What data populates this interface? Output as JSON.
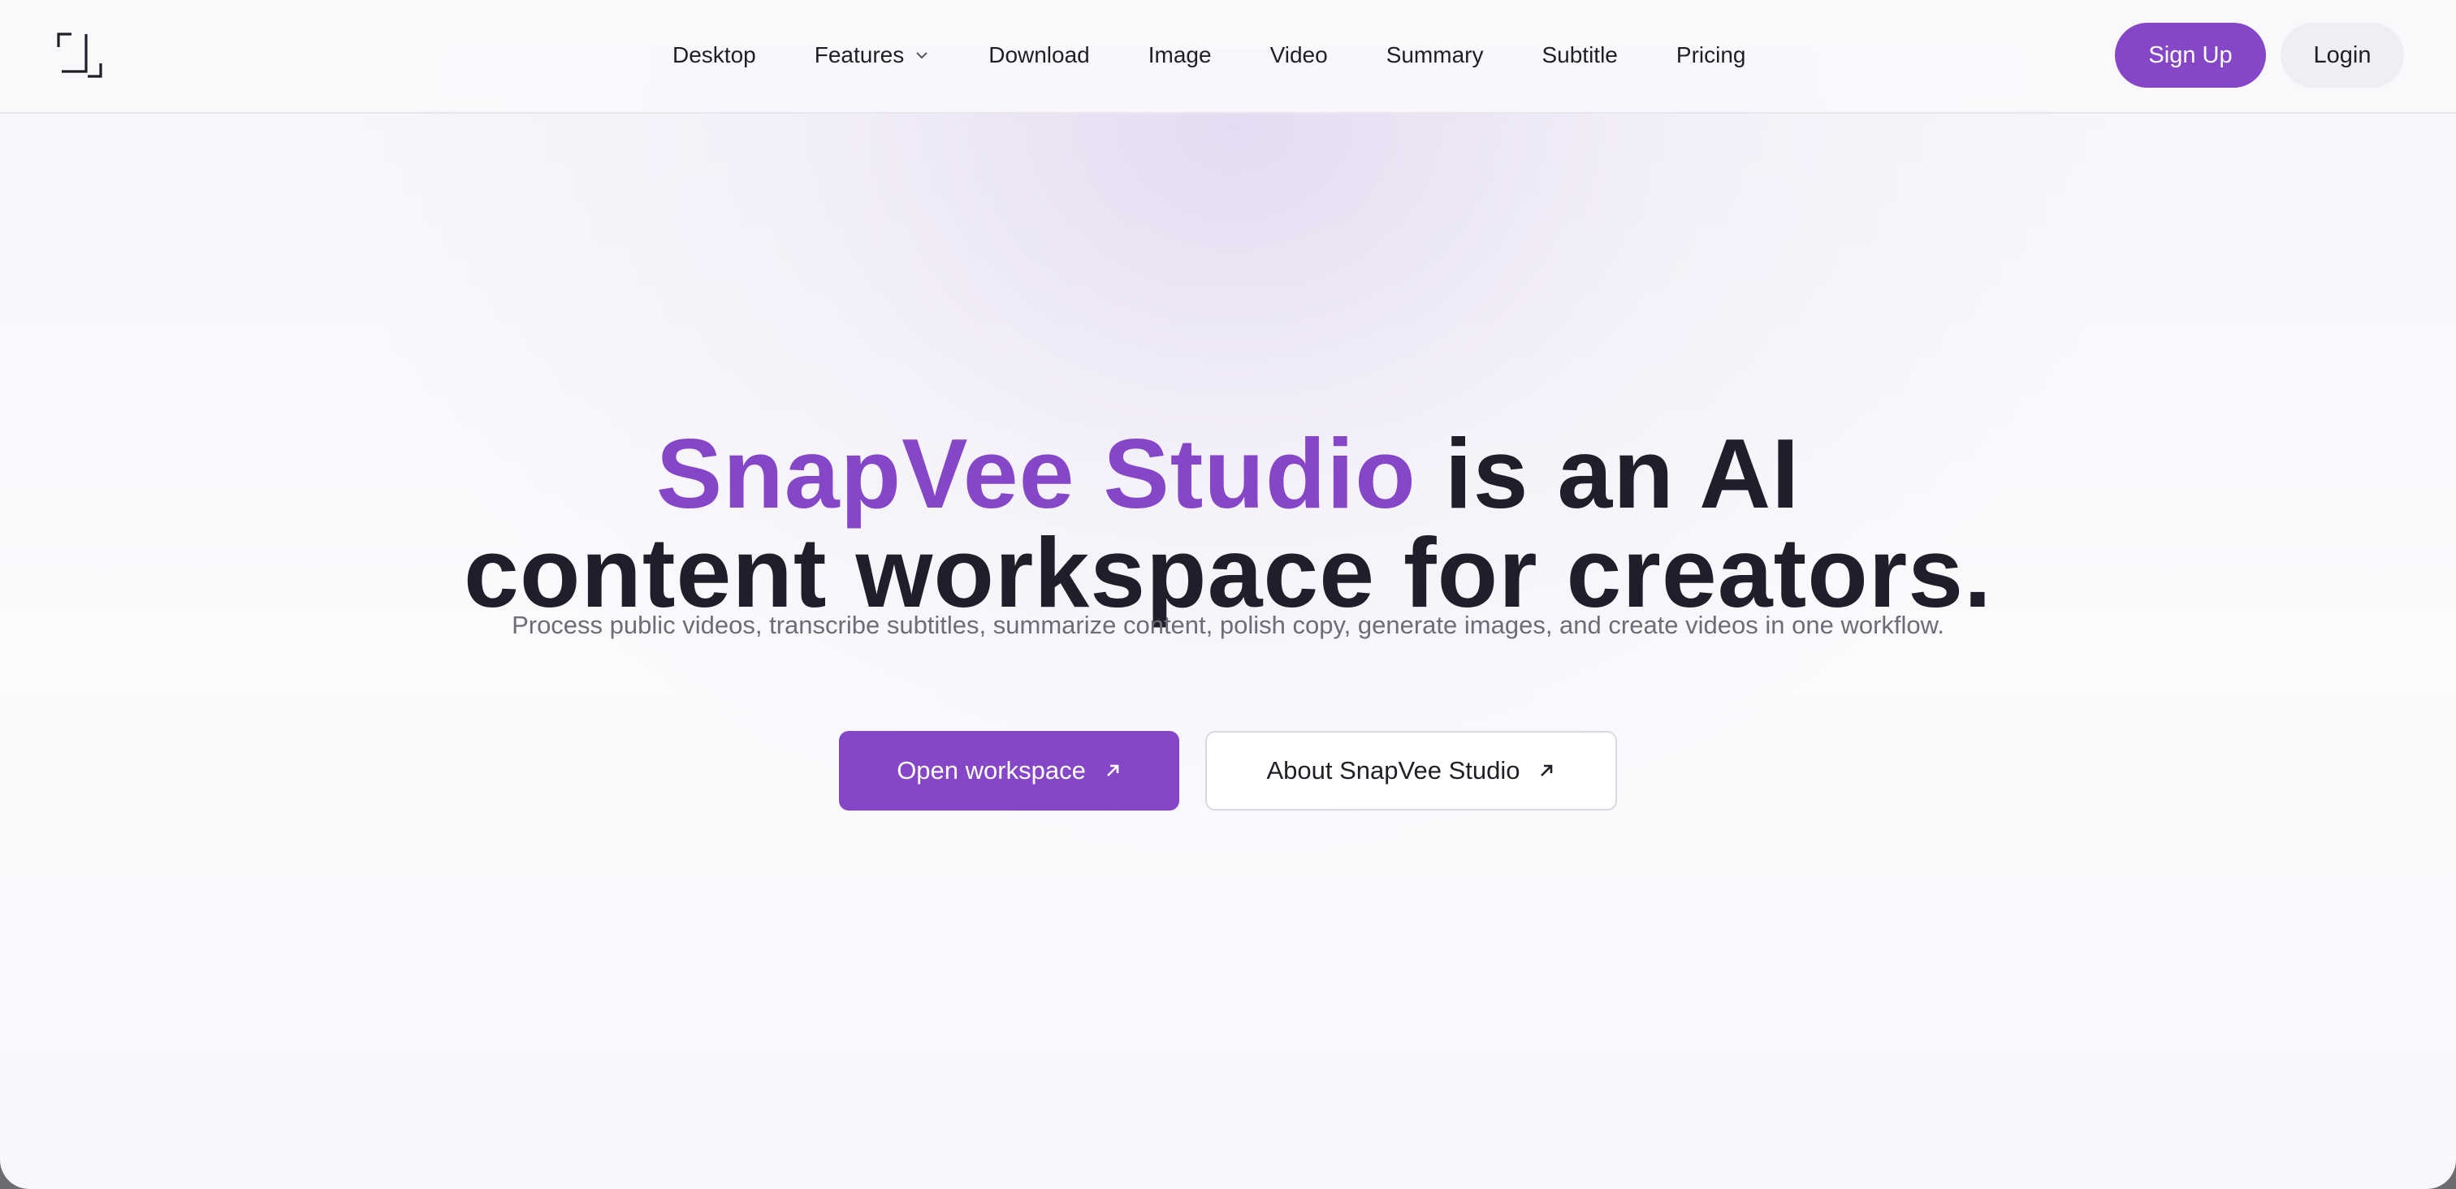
{
  "header": {
    "logo_icon": "bracket-corners-logo-icon",
    "nav": [
      {
        "label": "Desktop"
      },
      {
        "label": "Features",
        "icon": "chevron-down-icon"
      },
      {
        "label": "Download"
      },
      {
        "label": "Image"
      },
      {
        "label": "Video"
      },
      {
        "label": "Summary"
      },
      {
        "label": "Subtitle"
      },
      {
        "label": "Pricing"
      }
    ],
    "signup_label": "Sign Up",
    "login_label": "Login"
  },
  "hero": {
    "title_accent": "SnapVee Studio",
    "title_rest_line1": " is an AI",
    "title_line2": "content workspace for creators.",
    "subtitle": "Process public videos, transcribe subtitles, summarize content, polish copy, generate images, and create videos in one workflow.",
    "primary_cta": "Open workspace",
    "secondary_cta": "About SnapVee Studio",
    "cta_icon": "arrow-up-right-icon"
  },
  "colors": {
    "accent": "#8547c7",
    "text_dark": "#1e1f2a",
    "text_muted": "#6d6c78",
    "login_bg": "#f0eef3"
  }
}
